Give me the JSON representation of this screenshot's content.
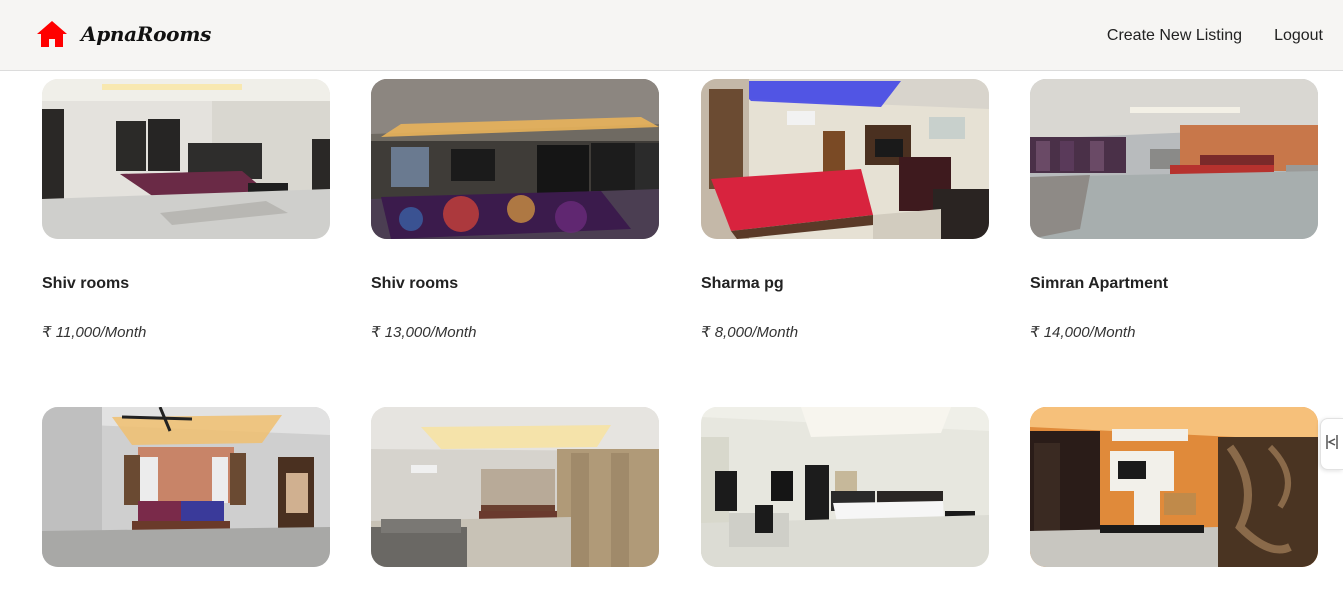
{
  "navbar": {
    "brand": "ApnaRooms",
    "brand_icon": "house-icon",
    "brand_color": "#ff0000",
    "links": [
      "Create New Listing",
      "Logout"
    ]
  },
  "listings": [
    {
      "title": "Shiv rooms",
      "price": "₹ 11,000/Month",
      "image": "bedroom-photo"
    },
    {
      "title": "Shiv rooms",
      "price": "₹ 13,000/Month",
      "image": "bedroom-photo"
    },
    {
      "title": "Sharma pg",
      "price": "₹ 8,000/Month",
      "image": "bedroom-photo"
    },
    {
      "title": "Simran Apartment",
      "price": "₹ 14,000/Month",
      "image": "bedroom-photo"
    },
    {
      "title": "",
      "price": "",
      "image": "bedroom-photo"
    },
    {
      "title": "",
      "price": "",
      "image": "bedroom-photo"
    },
    {
      "title": "",
      "price": "",
      "image": "bedroom-photo"
    },
    {
      "title": "",
      "price": "",
      "image": "bedroom-photo"
    }
  ],
  "side_tab": {
    "icon": "collapse-arrows-icon"
  }
}
